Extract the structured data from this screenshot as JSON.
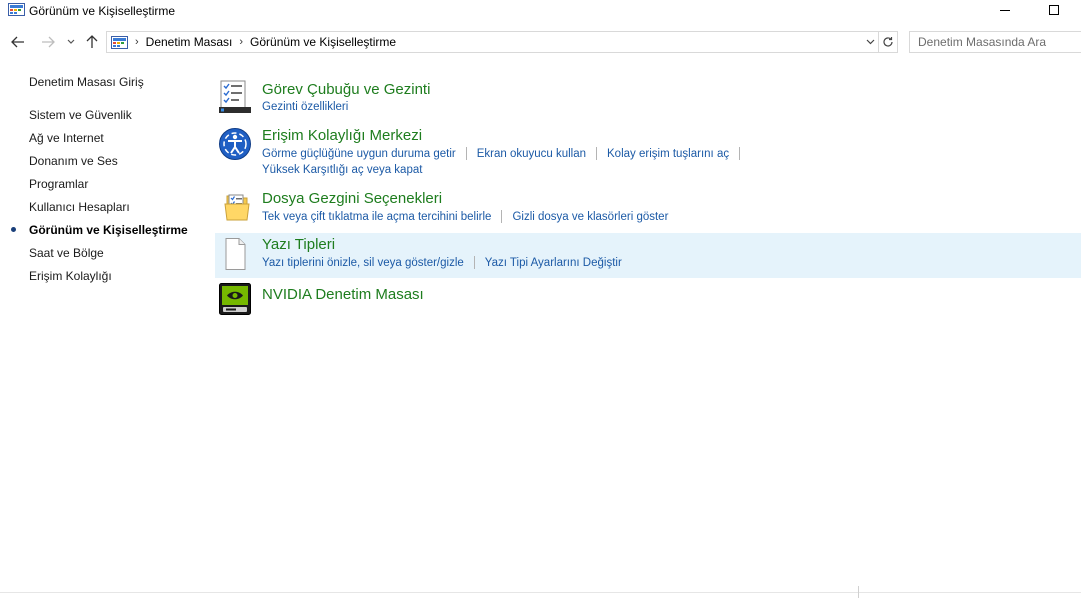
{
  "window": {
    "title": "Görünüm ve Kişiselleştirme"
  },
  "breadcrumb": [
    "Denetim Masası",
    "Görünüm ve Kişiselleştirme"
  ],
  "search": {
    "placeholder": "Denetim Masasında Ara"
  },
  "sidebar": {
    "items": [
      {
        "label": "Denetim Masası Giriş"
      },
      {
        "label": "Sistem ve Güvenlik"
      },
      {
        "label": "Ağ ve Internet"
      },
      {
        "label": "Donanım ve Ses"
      },
      {
        "label": "Programlar"
      },
      {
        "label": "Kullanıcı Hesapları"
      },
      {
        "label": "Görünüm ve Kişiselleştirme",
        "active": true
      },
      {
        "label": "Saat ve Bölge"
      },
      {
        "label": "Erişim Kolaylığı"
      }
    ]
  },
  "categories": [
    {
      "title": "Görev Çubuğu ve Gezinti",
      "icon": "taskbar-icon",
      "links": [
        "Gezinti özellikleri"
      ]
    },
    {
      "title": "Erişim Kolaylığı Merkezi",
      "icon": "ease-of-access-icon",
      "links": [
        "Görme güçlüğüne uygun duruma getir",
        "Ekran okuyucu kullan",
        "Kolay erişim tuşlarını aç",
        "Yüksek Karşıtlığı aç veya kapat"
      ]
    },
    {
      "title": "Dosya Gezgini Seçenekleri",
      "icon": "folder-options-icon",
      "links": [
        "Tek veya çift tıklatma ile açma tercihini belirle",
        "Gizli dosya ve klasörleri göster"
      ]
    },
    {
      "title": "Yazı Tipleri",
      "icon": "fonts-icon",
      "links": [
        "Yazı tiplerini önizle, sil veya göster/gizle",
        "Yazı Tipi Ayarlarını Değiştir"
      ]
    },
    {
      "title": "NVIDIA Denetim Masası",
      "icon": "nvidia-icon",
      "links": []
    }
  ],
  "colors": {
    "category_title": "#1e7d1e",
    "link": "#1c5aa6",
    "hover_row": "#e5f3fb"
  }
}
